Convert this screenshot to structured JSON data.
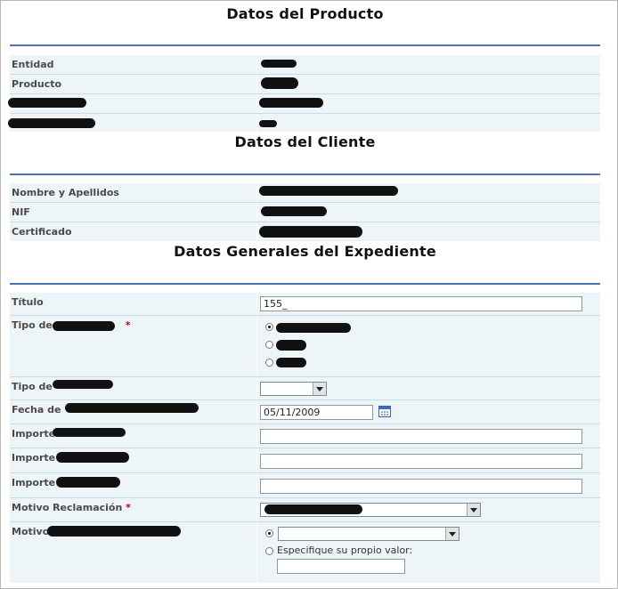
{
  "producto": {
    "title": "Datos del Producto",
    "rows": [
      {
        "label": "Entidad"
      },
      {
        "label": "Producto"
      },
      {
        "label": ""
      },
      {
        "label": ""
      }
    ]
  },
  "cliente": {
    "title": "Datos del Cliente",
    "rows": [
      {
        "label": "Nombre y Apellidos"
      },
      {
        "label": "NIF"
      },
      {
        "label": "Certificado"
      }
    ]
  },
  "expediente": {
    "title": "Datos Generales del Expediente",
    "titulo": {
      "label": "Título",
      "value": "155_"
    },
    "tipo1": {
      "label": "Tipo de",
      "required": "*",
      "options_selected_index": 0
    },
    "tipo2": {
      "label": "Tipo de",
      "value": ""
    },
    "fecha": {
      "label": "Fecha de",
      "value": "05/11/2009",
      "icon": "calendar-icon"
    },
    "importe1": {
      "label": "Importe",
      "value": ""
    },
    "importe2": {
      "label": "Importe",
      "value": ""
    },
    "importe3": {
      "label": "Importe",
      "value": ""
    },
    "motivo_reclamacion": {
      "label": "Motivo Reclamación",
      "required": "*"
    },
    "motivo": {
      "label": "Motivo",
      "select_value": "",
      "custom_option_label": "Especifique su propio valor:",
      "custom_value": ""
    }
  }
}
